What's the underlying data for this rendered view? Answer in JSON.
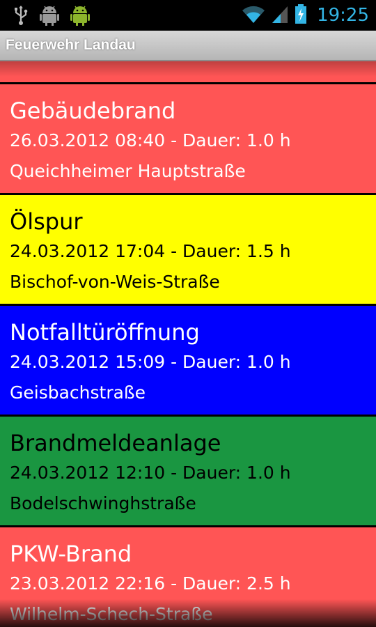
{
  "status_bar": {
    "time": "19:25",
    "icons": [
      "usb-icon",
      "android-debug-icon",
      "android-robot-icon",
      "wifi-icon",
      "signal-icon",
      "battery-charging-icon"
    ],
    "clock_color": "#33b5e5"
  },
  "action_bar": {
    "title": "Feuerwehr Landau"
  },
  "list": {
    "items": [
      {
        "title": "",
        "meta": "",
        "street": "Queichheimer Hauptstraße",
        "bg": "#ff5555",
        "fg": "#ffffff"
      },
      {
        "title": "Gebäudebrand",
        "meta": "26.03.2012 08:40 - Dauer: 1.0 h",
        "street": "Queichheimer Hauptstraße",
        "bg": "#ff5555",
        "fg": "#ffffff"
      },
      {
        "title": "Ölspur",
        "meta": "24.03.2012 17:04 - Dauer: 1.5 h",
        "street": "Bischof-von-Weis-Straße",
        "bg": "#ffff00",
        "fg": "#000000"
      },
      {
        "title": "Notfalltüröffnung",
        "meta": "24.03.2012 15:09 - Dauer: 1.0 h",
        "street": "Geisbachstraße",
        "bg": "#0000ff",
        "fg": "#ffffff"
      },
      {
        "title": "Brandmeldeanlage",
        "meta": "24.03.2012 12:10 - Dauer: 1.0 h",
        "street": "Bodelschwinghstraße",
        "bg": "#1a9641",
        "fg": "#000000"
      },
      {
        "title": "PKW-Brand",
        "meta": "23.03.2012 22:16 - Dauer: 2.5 h",
        "street": "Wilhelm-Schech-Straße",
        "bg": "#ff5555",
        "fg": "#ffffff"
      }
    ]
  }
}
